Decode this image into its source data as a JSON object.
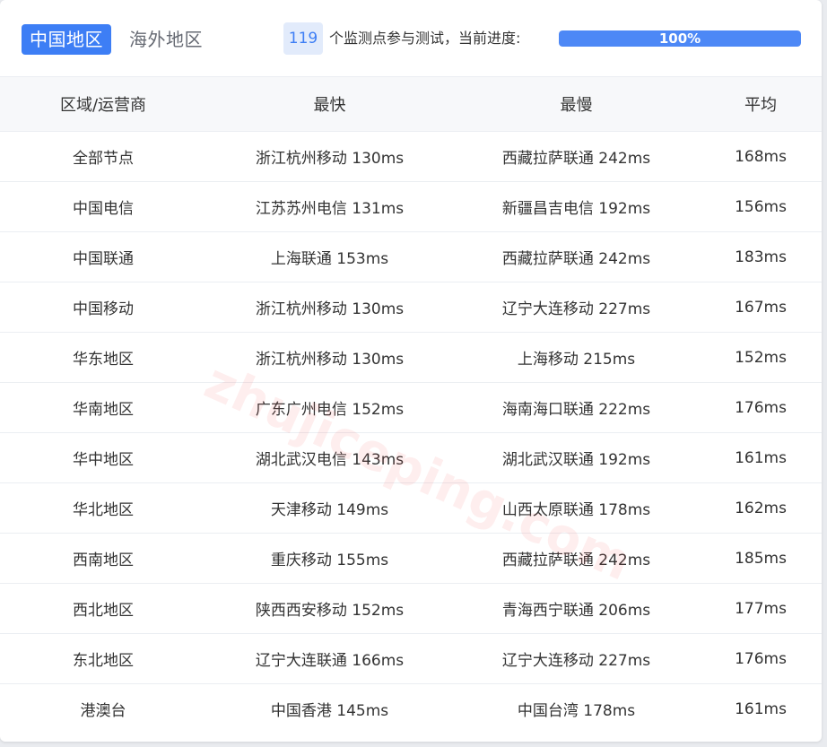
{
  "tabs": {
    "active": "中国地区",
    "inactive": "海外地区"
  },
  "progress": {
    "count": "119",
    "label": "个监测点参与测试，当前进度:",
    "percent_text": "100%",
    "percent": 100
  },
  "table": {
    "headers": [
      "区域/运营商",
      "最快",
      "最慢",
      "平均"
    ],
    "rows": [
      [
        "全部节点",
        "浙江杭州移动 130ms",
        "西藏拉萨联通 242ms",
        "168ms"
      ],
      [
        "中国电信",
        "江苏苏州电信 131ms",
        "新疆昌吉电信 192ms",
        "156ms"
      ],
      [
        "中国联通",
        "上海联通 153ms",
        "西藏拉萨联通 242ms",
        "183ms"
      ],
      [
        "中国移动",
        "浙江杭州移动 130ms",
        "辽宁大连移动 227ms",
        "167ms"
      ],
      [
        "华东地区",
        "浙江杭州移动 130ms",
        "上海移动 215ms",
        "152ms"
      ],
      [
        "华南地区",
        "广东广州电信 152ms",
        "海南海口联通 222ms",
        "176ms"
      ],
      [
        "华中地区",
        "湖北武汉电信 143ms",
        "湖北武汉联通 192ms",
        "161ms"
      ],
      [
        "华北地区",
        "天津移动 149ms",
        "山西太原联通 178ms",
        "162ms"
      ],
      [
        "西南地区",
        "重庆移动 155ms",
        "西藏拉萨联通 242ms",
        "185ms"
      ],
      [
        "西北地区",
        "陕西西安移动 152ms",
        "青海西宁联通 206ms",
        "177ms"
      ],
      [
        "东北地区",
        "辽宁大连联通 166ms",
        "辽宁大连移动 227ms",
        "176ms"
      ],
      [
        "港澳台",
        "中国香港 145ms",
        "中国台湾 178ms",
        "161ms"
      ]
    ]
  },
  "watermark": "zhujiceping.com",
  "colors": {
    "accent": "#3d7ef5",
    "progress_fill": "#4d88f6",
    "badge_bg": "#e2ebfb",
    "header_bg": "#f7f8fa"
  }
}
